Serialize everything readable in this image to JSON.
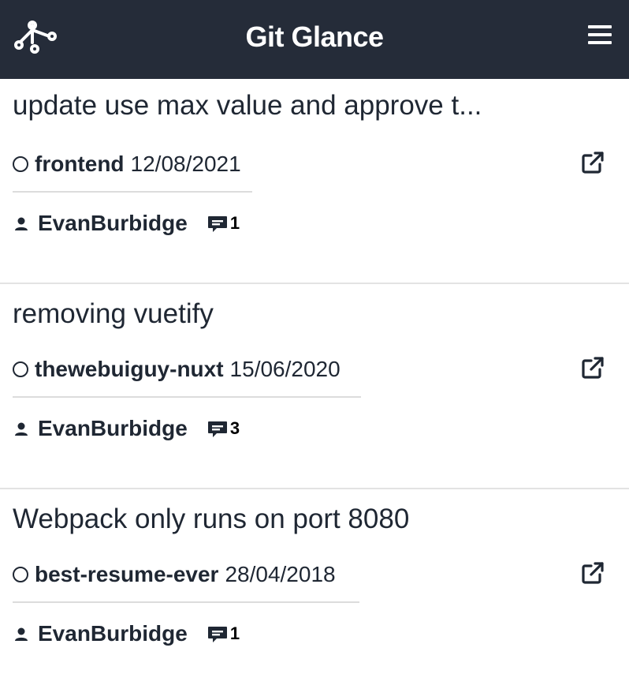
{
  "header": {
    "title": "Git Glance",
    "logo_icon": "git-merge-icon",
    "menu_icon": "hamburger-menu-icon",
    "background_color": "#252c39"
  },
  "pull_requests": [
    {
      "title": "update use max value and approve t...",
      "repo": "frontend",
      "date": "12/08/2021",
      "author": "EvanBurbidge",
      "comments": "1"
    },
    {
      "title": "removing vuetify",
      "repo": "thewebuiguy-nuxt",
      "date": "15/06/2020",
      "author": "EvanBurbidge",
      "comments": "3"
    },
    {
      "title": "Webpack only runs on port 8080",
      "repo": "best-resume-ever",
      "date": "28/04/2018",
      "author": "EvanBurbidge",
      "comments": "1"
    }
  ],
  "icons": {
    "status": "open-circle-icon",
    "external_link": "external-link-icon",
    "author": "person-icon",
    "comments": "comment-icon"
  }
}
